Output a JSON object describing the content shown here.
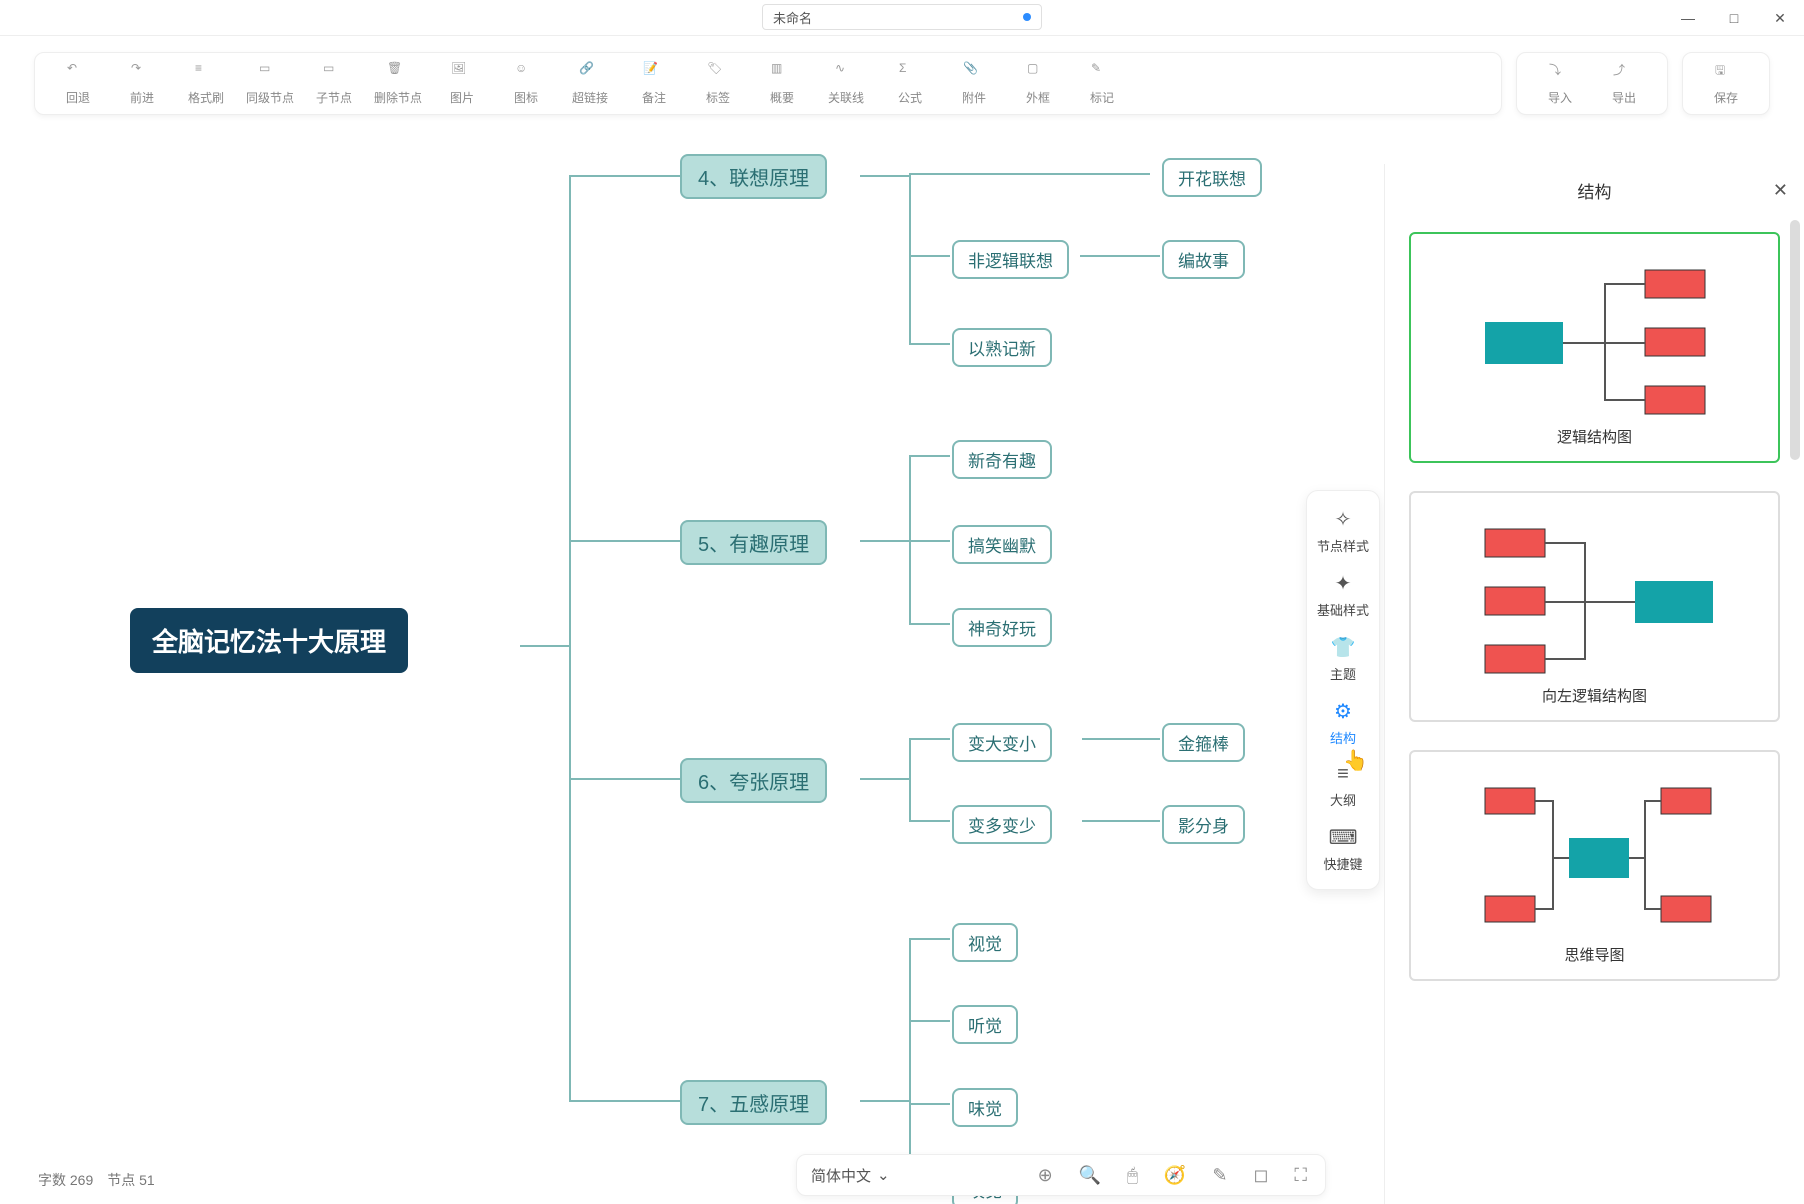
{
  "title": "未命名",
  "window_controls": {
    "min": "—",
    "max": "□",
    "close": "✕"
  },
  "toolbar": [
    {
      "id": "undo",
      "label": "回退"
    },
    {
      "id": "redo",
      "label": "前进"
    },
    {
      "id": "format",
      "label": "格式刷"
    },
    {
      "id": "sibling",
      "label": "同级节点"
    },
    {
      "id": "child",
      "label": "子节点"
    },
    {
      "id": "delete",
      "label": "删除节点"
    },
    {
      "id": "image",
      "label": "图片"
    },
    {
      "id": "icon",
      "label": "图标"
    },
    {
      "id": "link",
      "label": "超链接"
    },
    {
      "id": "note",
      "label": "备注"
    },
    {
      "id": "tag",
      "label": "标签"
    },
    {
      "id": "summary",
      "label": "概要"
    },
    {
      "id": "relation",
      "label": "关联线"
    },
    {
      "id": "formula",
      "label": "公式"
    },
    {
      "id": "attach",
      "label": "附件"
    },
    {
      "id": "frame",
      "label": "外框"
    },
    {
      "id": "marker",
      "label": "标记"
    }
  ],
  "io": {
    "import": "导入",
    "export": "导出",
    "save": "保存"
  },
  "mindmap": {
    "root": "全脑记忆法十大原理",
    "branches": [
      {
        "num": "4、",
        "name": "联想原理",
        "children": [
          {
            "name": "",
            "sub": [
              {
                "name": "开花联想"
              }
            ]
          },
          {
            "name": "非逻辑联想",
            "sub": [
              {
                "name": "编故事"
              }
            ]
          },
          {
            "name": "以熟记新"
          }
        ]
      },
      {
        "num": "5、",
        "name": "有趣原理",
        "children": [
          {
            "name": "新奇有趣"
          },
          {
            "name": "搞笑幽默"
          },
          {
            "name": "神奇好玩"
          }
        ]
      },
      {
        "num": "6、",
        "name": "夸张原理",
        "children": [
          {
            "name": "变大变小",
            "sub": [
              {
                "name": "金箍棒"
              }
            ]
          },
          {
            "name": "变多变少",
            "sub": [
              {
                "name": "影分身"
              }
            ]
          }
        ]
      },
      {
        "num": "7、",
        "name": "五感原理",
        "children": [
          {
            "name": "视觉"
          },
          {
            "name": "听觉"
          },
          {
            "name": "味觉"
          },
          {
            "name": "嗅觉"
          }
        ]
      }
    ]
  },
  "sidestrip": [
    {
      "id": "nodestyle",
      "label": "节点样式",
      "icon": "✧"
    },
    {
      "id": "basestyle",
      "label": "基础样式",
      "icon": "✦"
    },
    {
      "id": "theme",
      "label": "主题",
      "icon": "👕"
    },
    {
      "id": "structure",
      "label": "结构",
      "icon": "⚙"
    },
    {
      "id": "outline",
      "label": "大纲",
      "icon": "≡"
    },
    {
      "id": "shortcut",
      "label": "快捷键",
      "icon": "⌨"
    }
  ],
  "panel": {
    "title": "结构",
    "items": [
      {
        "id": "logic",
        "caption": "逻辑结构图",
        "selected": true
      },
      {
        "id": "leftlogic",
        "caption": "向左逻辑结构图"
      },
      {
        "id": "mindmap",
        "caption": "思维导图"
      }
    ]
  },
  "status": {
    "word_label": "字数",
    "word_count": "269",
    "node_label": "节点",
    "node_count": "51"
  },
  "viewbar": {
    "lang": "简体中文"
  },
  "colors": {
    "teal": "#1aa7a7",
    "red": "#ef5350",
    "line": "#666"
  }
}
